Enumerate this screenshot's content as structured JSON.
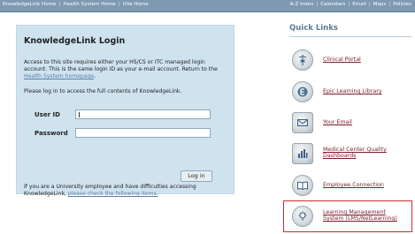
{
  "top_nav": {
    "left": [
      "KnowledgeLink Home",
      "Health System Home",
      "UVa Home"
    ],
    "right": [
      "A-Z Index",
      "Calendars",
      "Email",
      "Maps",
      "Policies"
    ]
  },
  "login": {
    "title": "KnowledgeLink Login",
    "intro_pre": "Access to this site requires either your HS/CS or ITC managed login account. This is the same login ID as your e-mail account. Return to the ",
    "intro_link": "Health System homepage",
    "intro_post": ".",
    "instruction": "Please log in to access the full contents of KnowledgeLink.",
    "user_id_label": "User ID",
    "password_label": "Password",
    "login_button": "Log in",
    "help_pre": "If you are a University employee and have difficulties accessing KnowledgeLink, ",
    "help_link": "please check the following items."
  },
  "quick_links": {
    "title": "Quick Links",
    "items": [
      {
        "label": "Clinical Portal",
        "icon": "caduceus-icon"
      },
      {
        "label": "Epic Learning Library",
        "icon": "epic-logo-icon"
      },
      {
        "label": "Your Email",
        "icon": "envelope-icon"
      },
      {
        "label_line1": "Medical Center Quality",
        "label_line2": "Dashboards",
        "icon": "bar-chart-icon"
      },
      {
        "label": "Employee Connection",
        "icon": "book-icon"
      },
      {
        "label_line1": "Learning Management",
        "label_line2": "System (LMS/NetLearning)",
        "icon": "lightbulb-icon"
      }
    ],
    "highlight_color": "#d42a2a"
  }
}
